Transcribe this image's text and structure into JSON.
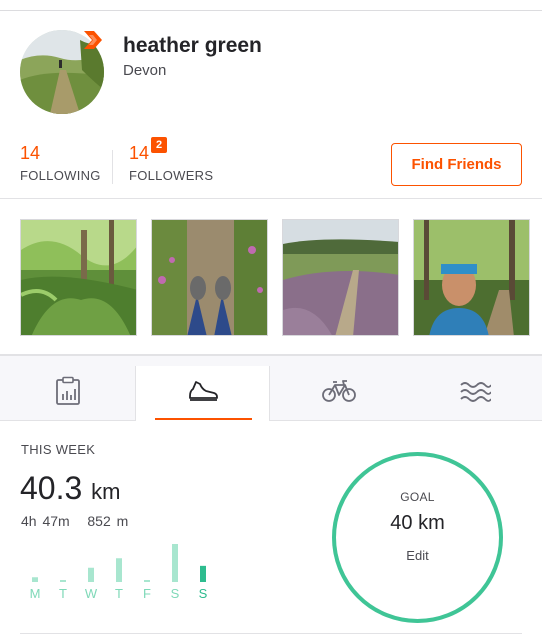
{
  "profile": {
    "name": "heather green",
    "location": "Devon"
  },
  "stats": {
    "following": {
      "value": "14",
      "label": "FOLLOWING"
    },
    "followers": {
      "value": "14",
      "label": "FOLLOWERS",
      "new_count": "2"
    }
  },
  "find_friends_label": "Find Friends",
  "photos": [
    {
      "subject": "woodland ferns"
    },
    {
      "subject": "hiking boots on trail"
    },
    {
      "subject": "heathland path"
    },
    {
      "subject": "runner selfie in woods"
    }
  ],
  "tabs": [
    {
      "icon": "clipboard-chart-icon",
      "active": false
    },
    {
      "icon": "running-shoe-icon",
      "active": true
    },
    {
      "icon": "bicycle-icon",
      "active": false
    },
    {
      "icon": "waves-icon",
      "active": false
    }
  ],
  "week": {
    "label": "THIS WEEK",
    "distance": "40.3",
    "unit": "km",
    "time": "4h 47m",
    "elevation": "852 m",
    "days": [
      "M",
      "T",
      "W",
      "T",
      "F",
      "S",
      "S"
    ],
    "daily_km": [
      0.5,
      0.2,
      1.5,
      2.5,
      0.2,
      4.0,
      1.7
    ]
  },
  "goal": {
    "label": "GOAL",
    "value": "40 km",
    "edit_label": "Edit",
    "progress": 1.0
  },
  "colors": {
    "accent": "#fc5200",
    "bar_light": "#a8e6cf",
    "bar_today": "#2ebc8f",
    "ring": "#3fc596",
    "day_light": "#7fd9b8"
  }
}
